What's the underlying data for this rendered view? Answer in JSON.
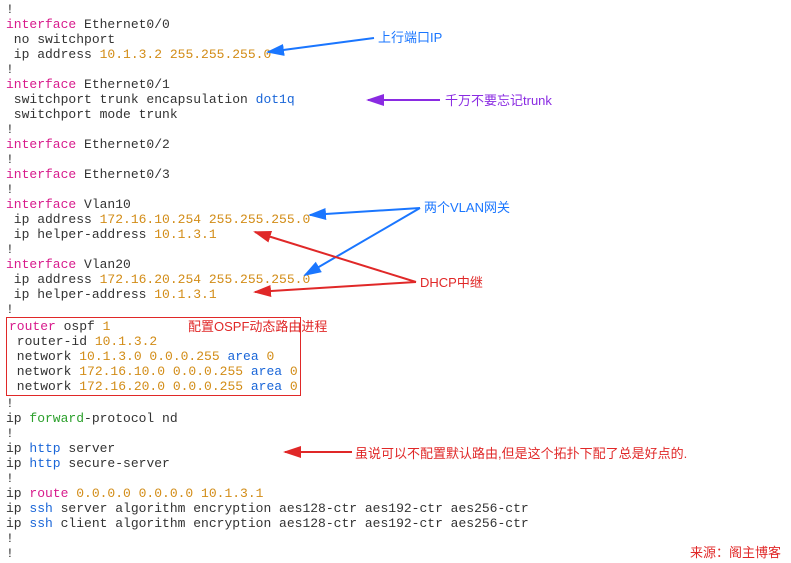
{
  "lines": {
    "l1": "!",
    "if00_hdr_pre": "interface",
    "if00_hdr_name": " Ethernet0/0",
    "if00_l1": " no switchport",
    "if00_l2_pre": " ip address ",
    "if00_l2_ip": "10.1.3.2 255.255.255.0",
    "if01_hdr_pre": "interface",
    "if01_hdr_name": " Ethernet0/1",
    "if01_l1_pre": " switchport trunk encapsulation ",
    "if01_l1_dot1q": "dot1q",
    "if01_l2": " switchport mode trunk",
    "if02_hdr_pre": "interface",
    "if02_hdr_name": " Ethernet0/2",
    "if03_hdr_pre": "interface",
    "if03_hdr_name": " Ethernet0/3",
    "vlan10_hdr_pre": "interface",
    "vlan10_hdr_name": " Vlan10",
    "vlan10_l1_pre": " ip address ",
    "vlan10_l1_ip": "172.16.10.254 255.255.255.0",
    "vlan10_l2_pre": " ip helper-address ",
    "vlan10_l2_ip": "10.1.3.1",
    "vlan20_hdr_pre": "interface",
    "vlan20_hdr_name": " Vlan20",
    "vlan20_l1_pre": " ip address ",
    "vlan20_l1_ip": "172.16.20.254 255.255.255.0",
    "vlan20_l2_pre": " ip helper-address ",
    "vlan20_l2_ip": "10.1.3.1",
    "ospf_l1_pre": "router",
    "ospf_l1_mid": " ospf ",
    "ospf_l1_num": "1",
    "ospf_l2_pre": " router-id ",
    "ospf_l2_ip": "10.1.3.2",
    "ospf_l3_pre": " network ",
    "ospf_l3_ip": "10.1.3.0 0.0.0.255",
    "ospf_l3_area": " area ",
    "ospf_l3_areanum": "0",
    "ospf_l4_pre": " network ",
    "ospf_l4_ip": "172.16.10.0 0.0.0.255",
    "ospf_l4_area": " area ",
    "ospf_l4_areanum": "0",
    "ospf_l5_pre": " network ",
    "ospf_l5_ip": "172.16.20.0 0.0.0.255",
    "ospf_l5_area": " area ",
    "ospf_l5_areanum": "0",
    "fwd_pre": "ip ",
    "fwd_mid": "forward",
    "fwd_post": "-protocol nd",
    "http1_pre": "ip ",
    "http1_mid": "http",
    "http1_post": " server",
    "http2_pre": "ip ",
    "http2_mid": "http",
    "http2_post": " secure-server",
    "route_pre": "ip ",
    "route_mid": "route ",
    "route_ip": "0.0.0.0 0.0.0.0 10.1.3.1",
    "ssh1_pre": "ip ",
    "ssh1_mid": "ssh",
    "ssh1_post": " server algorithm encryption aes128-ctr aes192-ctr aes256-ctr",
    "ssh2_pre": "ip ",
    "ssh2_mid": "ssh",
    "ssh2_post": " client algorithm encryption aes128-ctr aes192-ctr aes256-ctr",
    "bang": "!"
  },
  "annotations": {
    "uplink_ip": "上行端口IP",
    "trunk_reminder": "千万不要忘记trunk",
    "vlan_gateways": "两个VLAN网关",
    "dhcp_relay": "DHCP中继",
    "ospf_box": "配置OSPF动态路由进程",
    "default_route": "虽说可以不配置默认路由,但是这个拓扑下配了总是好点的.",
    "source": "来源：阁主博客"
  }
}
